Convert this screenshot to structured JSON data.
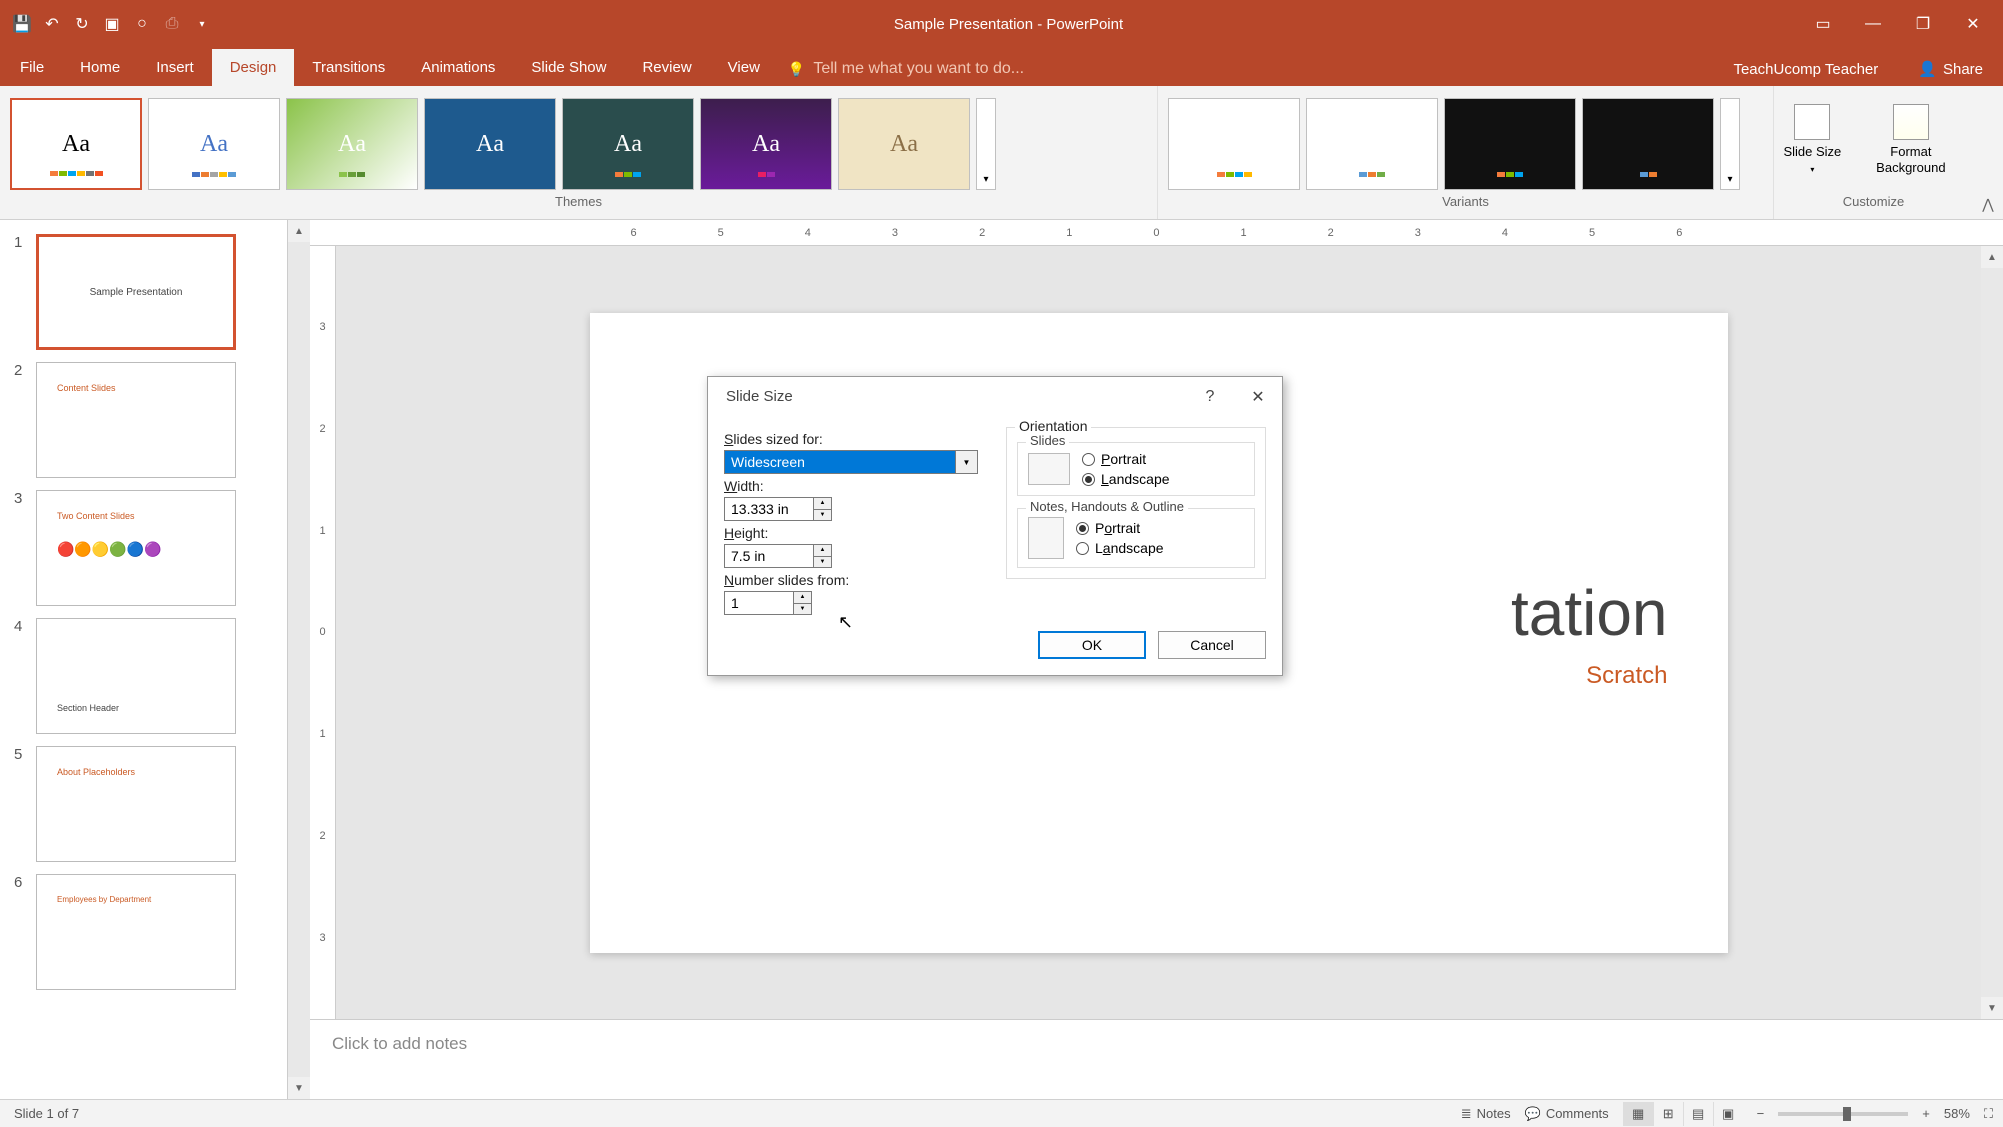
{
  "titlebar": {
    "title": "Sample Presentation - PowerPoint"
  },
  "tabs": {
    "file": "File",
    "home": "Home",
    "insert": "Insert",
    "design": "Design",
    "transitions": "Transitions",
    "animations": "Animations",
    "slideshow": "Slide Show",
    "review": "Review",
    "view": "View"
  },
  "tell_me": "Tell me what you want to do...",
  "user": "TeachUcomp Teacher",
  "share": "Share",
  "groups": {
    "themes": "Themes",
    "variants": "Variants",
    "customize": "Customize"
  },
  "customize": {
    "slide_size": "Slide Size",
    "format_bg": "Format Background"
  },
  "dialog": {
    "title": "Slide Size",
    "sized_for_label": "Slides sized for:",
    "sized_for_value": "Widescreen",
    "width_label": "Width:",
    "width_value": "13.333 in",
    "height_label": "Height:",
    "height_value": "7.5 in",
    "number_label": "Number slides from:",
    "number_value": "1",
    "orientation": "Orientation",
    "slides": "Slides",
    "notes": "Notes, Handouts & Outline",
    "portrait": "Portrait",
    "landscape": "Landscape",
    "ok": "OK",
    "cancel": "Cancel"
  },
  "slide": {
    "title": "tation",
    "subtitle": "Scratch"
  },
  "notes_placeholder": "Click to add notes",
  "status": {
    "left": "Slide 1 of 7",
    "notes": "Notes",
    "comments": "Comments",
    "zoom": "58%"
  },
  "thumbs": {
    "t1": "Sample Presentation",
    "t2": "Content Slides",
    "t3": "Two Content Slides",
    "t4": "Section Header",
    "t5": "About Placeholders",
    "t6": "Employees by Department"
  }
}
